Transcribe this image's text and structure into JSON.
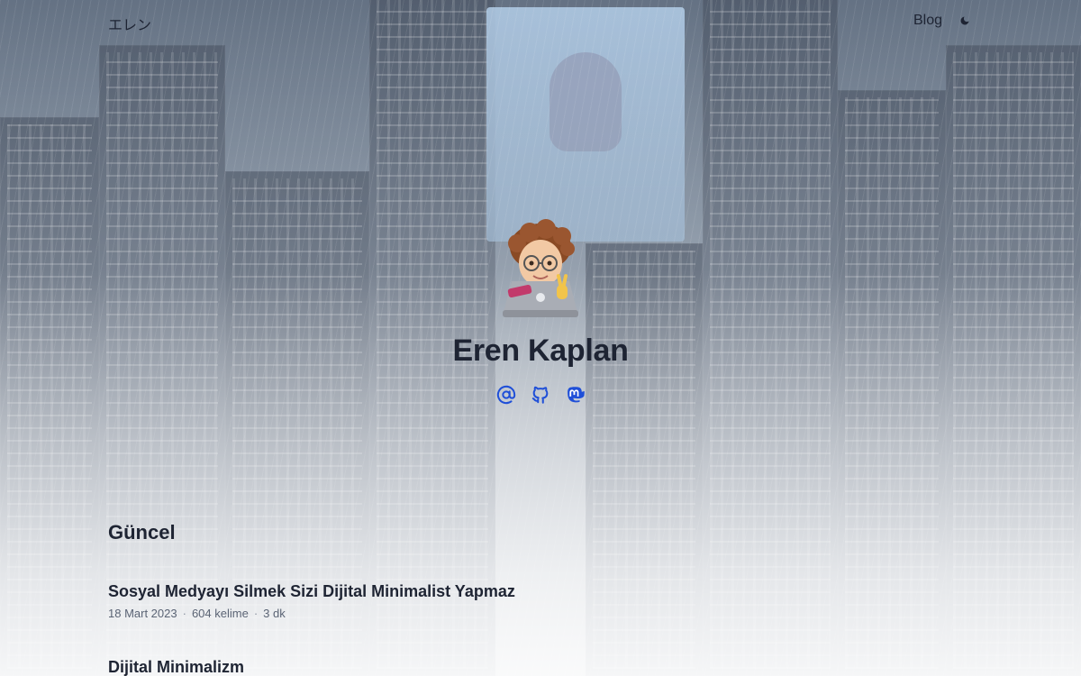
{
  "header": {
    "logo": "エレン",
    "nav": [
      {
        "label": "Blog"
      }
    ],
    "theme_icon": "moon-icon"
  },
  "profile": {
    "name": "Eren Kaplan",
    "avatar_icon": "memoji-avatar",
    "socials": [
      {
        "icon": "at-sign-icon"
      },
      {
        "icon": "github-icon"
      },
      {
        "icon": "mastodon-icon"
      }
    ]
  },
  "recent": {
    "title": "Güncel",
    "posts": [
      {
        "title": "Sosyal Medyayı Silmek Sizi Dijital Minimalist Yapmaz",
        "date": "18 Mart 2023",
        "words": "604 kelime",
        "read_time": "3 dk"
      },
      {
        "title": "Dijital Minimalizm"
      }
    ],
    "meta_separator": "·"
  },
  "colors": {
    "text": "#1e2433",
    "accent": "#1f4fd8",
    "meta": "#5b6475"
  }
}
